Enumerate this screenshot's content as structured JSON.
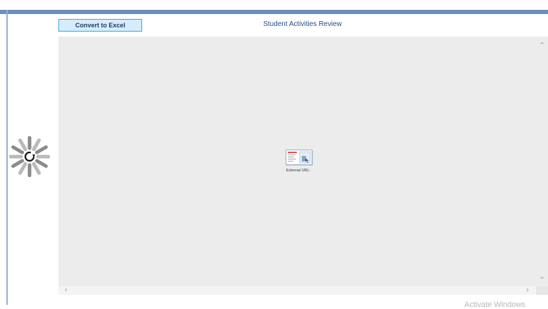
{
  "toolbar": {
    "convert_label": "Convert to Excel"
  },
  "header": {
    "title": "Student Activities Review"
  },
  "viewer": {
    "external_label": "External URL:"
  },
  "scrollbars": {
    "up_arrow": "⌃",
    "down_arrow": "⌄",
    "left_arrow": "‹",
    "right_arrow": "›"
  },
  "watermark": {
    "text": "Activate Windows"
  },
  "colors": {
    "accent": "#6a8fbf",
    "title": "#1f4e8a",
    "button_bg": "#d6ecfa",
    "button_border": "#39a7dc",
    "viewer_bg": "#ececec"
  },
  "icons": {
    "spinner": "loading-spinner-icon",
    "thumbnail": "external-url-thumbnail-icon"
  }
}
